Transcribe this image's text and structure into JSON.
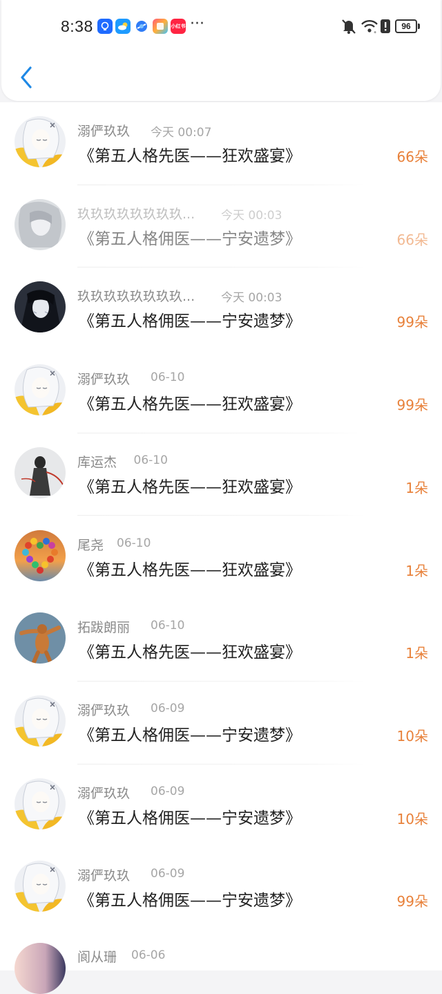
{
  "status_bar": {
    "time": "8:38",
    "app_icons": [
      {
        "name": "bulb-app-icon",
        "color": "#1f6bff"
      },
      {
        "name": "weather-app-icon",
        "color": "#1e9bff"
      },
      {
        "name": "browser-app-icon",
        "color": "#2f7cf6"
      },
      {
        "name": "gallery-app-icon",
        "color": "#f07b3f"
      },
      {
        "name": "xiaohongshu-app-icon",
        "color": "#ff2442",
        "label": "小红书"
      }
    ],
    "more": "···",
    "battery": "96"
  },
  "header": {
    "back_icon": "chevron-left-icon",
    "accent": "#1e88e5"
  },
  "colors": {
    "count": "#e8813a",
    "name": "#8a8a8a",
    "title": "#222222"
  },
  "records": [
    {
      "name": "溺俨玖玖",
      "time": "今天 00:07",
      "title": "《第五人格先医——狂欢盛宴》",
      "count": "66朵",
      "avatar": "anime-girl-yellow",
      "faded": false
    },
    {
      "name": "玖玖玖玖玖玖玖玖...",
      "time": "今天 00:03",
      "title": "《第五人格佣医——宁安遗梦》",
      "count": "66朵",
      "avatar": "anime-girl-grey",
      "faded": true
    },
    {
      "name": "玖玖玖玖玖玖玖玖...",
      "time": "今天 00:03",
      "title": "《第五人格佣医——宁安遗梦》",
      "count": "99朵",
      "avatar": "anime-girl-dark",
      "faded": false
    },
    {
      "name": "溺俨玖玖",
      "time": "06-10",
      "title": "《第五人格先医——狂欢盛宴》",
      "count": "99朵",
      "avatar": "anime-girl-yellow",
      "faded": false
    },
    {
      "name": "库运杰",
      "time": "06-10",
      "title": "《第五人格先医——狂欢盛宴》",
      "count": "1朵",
      "avatar": "ink-warrior",
      "faded": false
    },
    {
      "name": "尾尧",
      "time": "06-10",
      "title": "《第五人格先医——狂欢盛宴》",
      "count": "1朵",
      "avatar": "balloon-heart",
      "faded": false
    },
    {
      "name": "拓跋朗丽",
      "time": "06-10",
      "title": "《第五人格先医——狂欢盛宴》",
      "count": "1朵",
      "avatar": "dancing-dog",
      "faded": false
    },
    {
      "name": "溺俨玖玖",
      "time": "06-09",
      "title": "《第五人格佣医——宁安遗梦》",
      "count": "10朵",
      "avatar": "anime-girl-yellow",
      "faded": false
    },
    {
      "name": "溺俨玖玖",
      "time": "06-09",
      "title": "《第五人格佣医——宁安遗梦》",
      "count": "10朵",
      "avatar": "anime-girl-yellow",
      "faded": false
    },
    {
      "name": "溺俨玖玖",
      "time": "06-09",
      "title": "《第五人格佣医——宁安遗梦》",
      "count": "99朵",
      "avatar": "anime-girl-yellow",
      "faded": false
    }
  ],
  "partial_record": {
    "name": "阆从珊",
    "time": "06-06"
  }
}
